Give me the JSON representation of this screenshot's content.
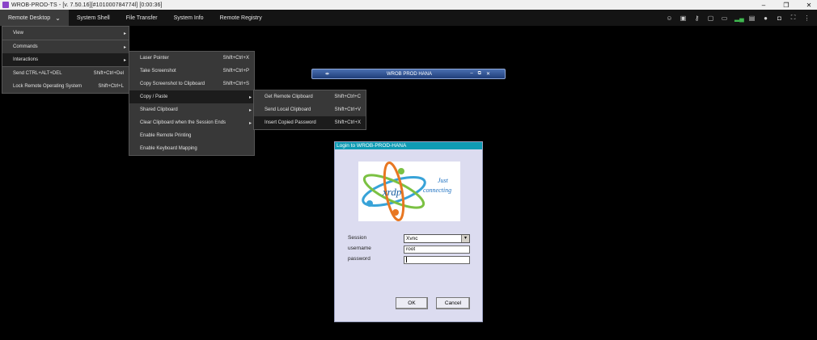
{
  "window": {
    "title": "WROB-PROD-TS - [v. 7.50.16][#101000784774l] [0:00:36]",
    "controls": [
      "–",
      "❐",
      "✕"
    ]
  },
  "menubar": {
    "remote_desktop": "Remote Desktop",
    "system_shell": "System Shell",
    "file_transfer": "File Transfer",
    "system_info": "System Info",
    "remote_registry": "Remote Registry"
  },
  "menu1": [
    {
      "label": "View",
      "shortcut": "",
      "arrow": "▸"
    },
    {
      "label": "Commands",
      "shortcut": "",
      "arrow": "▸"
    },
    {
      "label": "Interactions",
      "shortcut": "",
      "arrow": "▸"
    },
    {
      "label": "Send CTRL+ALT+DEL",
      "shortcut": "Shift+Ctrl+Del",
      "arrow": ""
    },
    {
      "label": "Lock Remote Operating System",
      "shortcut": "Shift+Ctrl+L",
      "arrow": ""
    }
  ],
  "menu2": [
    {
      "label": "Laser Pointer",
      "shortcut": "Shift+Ctrl+X",
      "arrow": ""
    },
    {
      "label": "Take Screenshot",
      "shortcut": "Shift+Ctrl+P",
      "arrow": ""
    },
    {
      "label": "Copy Screenshot to Clipboard",
      "shortcut": "Shift+Ctrl+S",
      "arrow": ""
    },
    {
      "label": "Copy / Paste",
      "shortcut": "",
      "arrow": "▸"
    },
    {
      "label": "Shared Clipboard",
      "shortcut": "",
      "arrow": "▸"
    },
    {
      "label": "Clear Clipboard when the Session Ends",
      "shortcut": "",
      "arrow": "▸"
    },
    {
      "label": "Enable Remote Printing",
      "shortcut": "",
      "arrow": ""
    },
    {
      "label": "Enable Keyboard Mapping",
      "shortcut": "",
      "arrow": ""
    }
  ],
  "menu3": [
    {
      "label": "Get Remote Clipboard",
      "shortcut": "Shift+Ctrl+C"
    },
    {
      "label": "Send Local Clipboard",
      "shortcut": "Shift+Ctrl+V"
    },
    {
      "label": "Insert Copied Password",
      "shortcut": "Shift+Ctrl+X"
    }
  ],
  "remote_window": {
    "title": "WROB PROD HANA",
    "controls": [
      "–",
      "⧉",
      "✕"
    ]
  },
  "login": {
    "title": "Login to WROB-PROD-HANA",
    "logo_text": "xrdp",
    "logo_tagline_1": "Just",
    "logo_tagline_2": "connecting",
    "session_label": "Session",
    "session_value": "Xvnc",
    "username_label": "username",
    "username_value": "root",
    "password_label": "password",
    "password_value": "",
    "ok_label": "OK",
    "cancel_label": "Cancel"
  },
  "colors": {
    "menu_bg": "#383838",
    "login_title": "#0f9bb4",
    "login_bg": "#dcdcf0"
  }
}
